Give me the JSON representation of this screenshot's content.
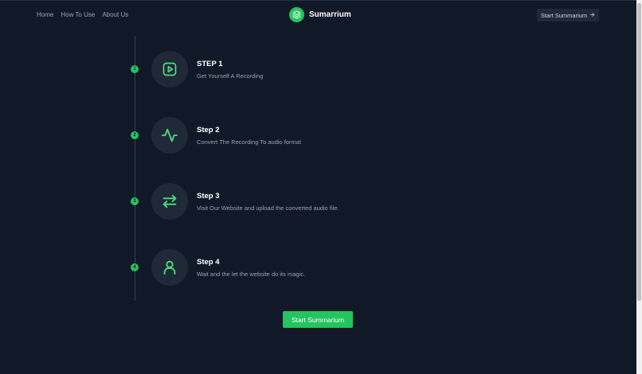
{
  "nav": {
    "links": [
      "Home",
      "How To Use",
      "About Us"
    ]
  },
  "brand": {
    "name": "Sumarrium",
    "logo_icon": "layers-icon"
  },
  "header_cta": {
    "label": "Start Summarium",
    "icon": "arrow-right-icon"
  },
  "steps": [
    {
      "number": "1",
      "title": "STEP 1",
      "description": "Get Yourself A Recording",
      "icon": "play-icon"
    },
    {
      "number": "2",
      "title": "Step 2",
      "description": "Convert The Recording To audio format",
      "icon": "activity-icon"
    },
    {
      "number": "3",
      "title": "Step 3",
      "description": "Visit Our Website and upload the converted audio file.",
      "icon": "arrows-swap-icon"
    },
    {
      "number": "4",
      "title": "Step 4",
      "description": "Wait and the let the website do its magic.",
      "icon": "user-icon"
    }
  ],
  "main_cta": {
    "label": "Start Summarium"
  },
  "colors": {
    "background": "#111827",
    "accent": "#22c55e",
    "card": "#1f2937"
  }
}
